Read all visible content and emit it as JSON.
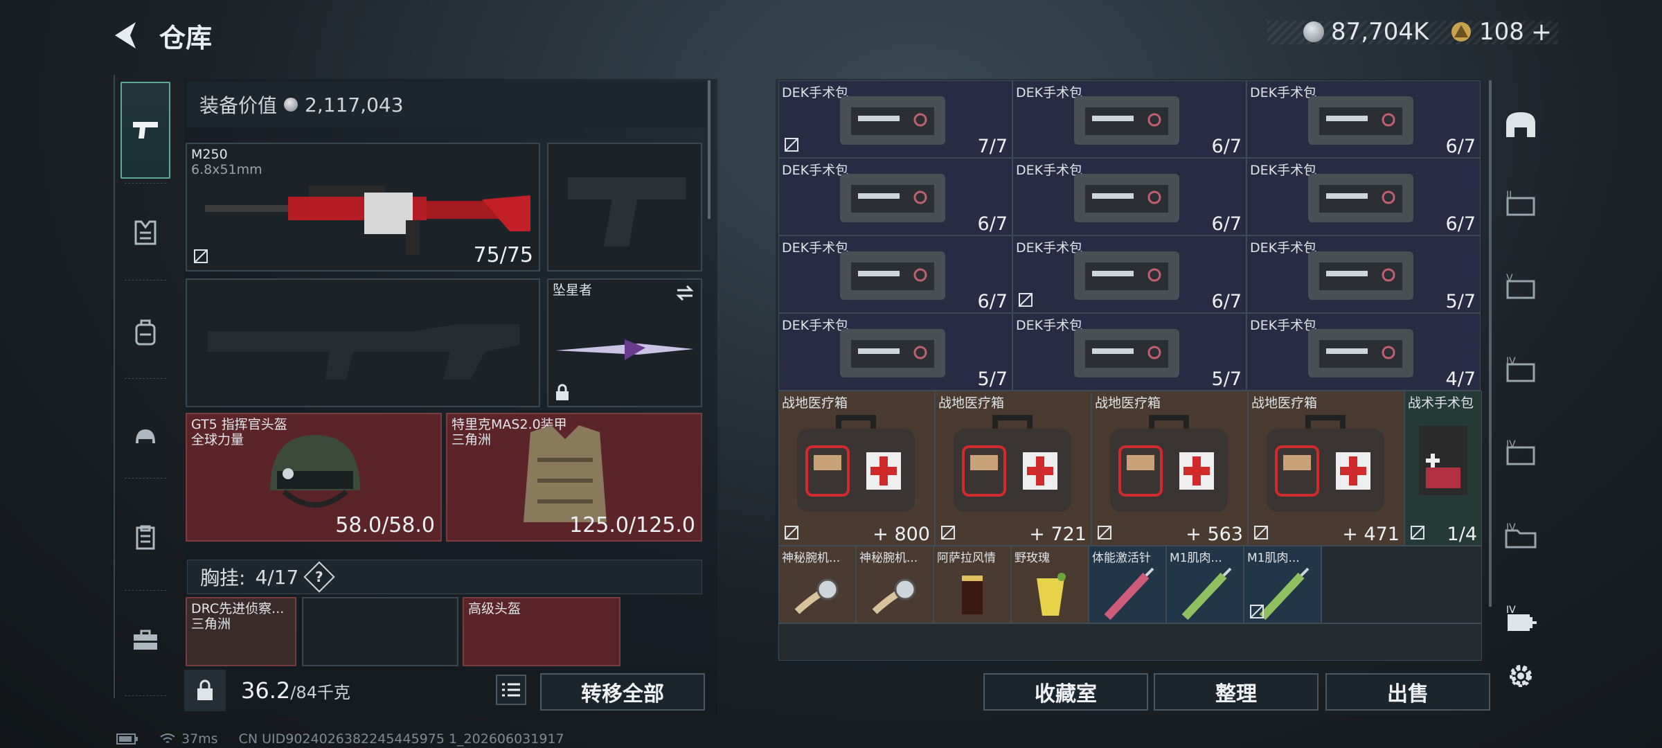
{
  "header": {
    "title": "仓库",
    "currency1": "87,704K",
    "currency2": "108",
    "plus": "+"
  },
  "nav": [
    "pistol-icon",
    "vest-icon",
    "backpack-icon",
    "helmet-icon",
    "clipboard-icon",
    "case-icon"
  ],
  "equipment": {
    "value_label": "装备价值",
    "value": "2,117,043",
    "primary": {
      "name": "M250",
      "caliber": "6.8x51mm",
      "durability": "75/75"
    },
    "melee": {
      "name": "坠星者"
    },
    "helmet": {
      "name": "GT5 指挥官头盔",
      "sub": "全球力量",
      "durability": "58.0/58.0"
    },
    "armor": {
      "name": "特里克MAS2.0装甲",
      "sub": "三角洲",
      "durability": "125.0/125.0"
    },
    "chest": {
      "label": "胸挂:",
      "count": "4/17",
      "help": "?"
    },
    "chest_items": [
      {
        "name": "DRC先进侦察...",
        "sub": "三角洲"
      },
      {
        "name": "高级头盔"
      }
    ],
    "weight": "36.2",
    "weight_max": "/84千克",
    "transfer_all": "转移全部"
  },
  "storage": {
    "med_rows": [
      [
        {
          "name": "DEK手术包",
          "count": "7/7"
        },
        {
          "name": "DEK手术包",
          "count": "6/7"
        },
        {
          "name": "DEK手术包",
          "count": "6/7"
        }
      ],
      [
        {
          "name": "DEK手术包",
          "count": "6/7"
        },
        {
          "name": "DEK手术包",
          "count": "6/7"
        },
        {
          "name": "DEK手术包",
          "count": "6/7"
        }
      ],
      [
        {
          "name": "DEK手术包",
          "count": "6/7"
        },
        {
          "name": "DEK手术包",
          "count": "6/7"
        },
        {
          "name": "DEK手术包",
          "count": "5/7"
        }
      ],
      [
        {
          "name": "DEK手术包",
          "count": "5/7"
        },
        {
          "name": "DEK手术包",
          "count": "5/7"
        },
        {
          "name": "DEK手术包",
          "count": "4/7"
        }
      ]
    ],
    "kits": [
      {
        "name": "战地医疗箱",
        "count": "800"
      },
      {
        "name": "战地医疗箱",
        "count": "721"
      },
      {
        "name": "战地医疗箱",
        "count": "563"
      },
      {
        "name": "战地医疗箱",
        "count": "471"
      },
      {
        "name": "战术手术包",
        "count": "1/4"
      }
    ],
    "small": [
      {
        "name": "神秘腕机..."
      },
      {
        "name": "神秘腕机..."
      },
      {
        "name": "阿萨拉风情"
      },
      {
        "name": "野玫瑰"
      },
      {
        "name": "体能激活针"
      },
      {
        "name": "M1肌肉..."
      },
      {
        "name": "M1肌肉..."
      }
    ],
    "buttons": {
      "collection": "收藏室",
      "sort": "整理",
      "sell": "出售"
    }
  },
  "status": {
    "ping": "37ms",
    "uid": "CN UID9024026382245445975 1_202606031917"
  },
  "colors": {
    "accent": "#5fa99a",
    "med_bg": "#272c44",
    "kit_bg": "#4a3a30",
    "armor_bg": "#5b2429"
  }
}
